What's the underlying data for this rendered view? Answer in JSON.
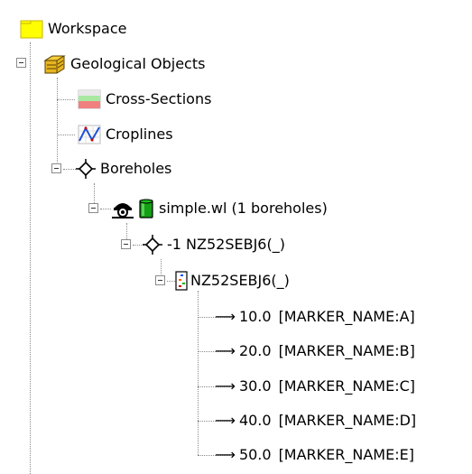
{
  "tree": {
    "workspace": {
      "label": "Workspace",
      "icon": "folder-icon"
    },
    "geological_objects": {
      "label": "Geological Objects",
      "icon": "geology-layers-icon"
    },
    "cross_sections": {
      "label": "Cross-Sections",
      "icon": "cross-sections-icon"
    },
    "croplines": {
      "label": "Croplines",
      "icon": "croplines-icon"
    },
    "boreholes": {
      "label": "Boreholes",
      "icon": "borehole-diamond-icon"
    },
    "well_file": {
      "label": "simple.wl (1 boreholes)",
      "icons": [
        "drill-rig-icon",
        "green-cylinder-icon"
      ]
    },
    "borehole_entry": {
      "label": "-1 NZ52SEBJ6(_)",
      "icon": "borehole-diamond-icon"
    },
    "borehole_log": {
      "label": "NZ52SEBJ6(_)",
      "icon": "borehole-log-icon"
    },
    "markers": [
      {
        "value": "10.0",
        "name": "[MARKER_NAME:A]"
      },
      {
        "value": "20.0",
        "name": "[MARKER_NAME:B]"
      },
      {
        "value": "30.0",
        "name": "[MARKER_NAME:C]"
      },
      {
        "value": "40.0",
        "name": "[MARKER_NAME:D]"
      },
      {
        "value": "50.0",
        "name": "[MARKER_NAME:E]"
      }
    ],
    "arrow_glyph": "⟶"
  },
  "colors": {
    "folder_yellow": "#ffff00",
    "geology_gold": "#c8a000",
    "cross_green": "#a8e8a0",
    "cross_red": "#f08080",
    "cylinder_green": "#14a014",
    "connector_gray": "#8a8a8a"
  }
}
